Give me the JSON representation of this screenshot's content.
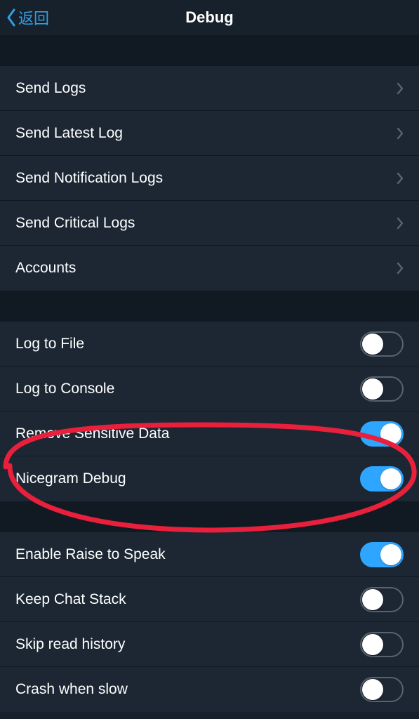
{
  "navbar": {
    "back_label": "返回",
    "title": "Debug"
  },
  "section1": [
    {
      "label": "Send Logs"
    },
    {
      "label": "Send Latest Log"
    },
    {
      "label": "Send Notification Logs"
    },
    {
      "label": "Send Critical Logs"
    },
    {
      "label": "Accounts"
    }
  ],
  "section2": [
    {
      "label": "Log to File",
      "on": false
    },
    {
      "label": "Log to Console",
      "on": false
    },
    {
      "label": "Remove Sensitive Data",
      "on": true
    },
    {
      "label": "Nicegram Debug",
      "on": true
    }
  ],
  "section3": [
    {
      "label": "Enable Raise to Speak",
      "on": true
    },
    {
      "label": "Keep Chat Stack",
      "on": false
    },
    {
      "label": "Skip read history",
      "on": false
    },
    {
      "label": "Crash when slow",
      "on": false
    }
  ]
}
